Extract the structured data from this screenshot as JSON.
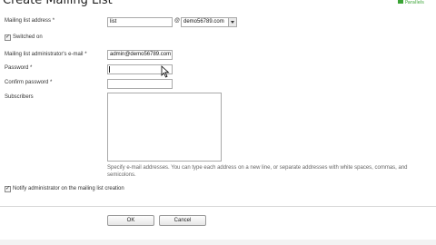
{
  "header": {
    "title": "Create Mailing List",
    "logo_text": "Parallels"
  },
  "form": {
    "mailing_list_address": {
      "label": "Mailing list address",
      "required_mark": "*",
      "value": "list",
      "at": "@",
      "domain_selected": "demo56789.com"
    },
    "switched_on": {
      "label": "Switched on",
      "checked": true,
      "check_glyph": "✓"
    },
    "admin_email": {
      "label": "Mailing list administrator's e-mail",
      "required_mark": "*",
      "value": "admin@demo56789.com"
    },
    "password": {
      "label": "Password",
      "required_mark": "*",
      "value": ""
    },
    "confirm_password": {
      "label": "Confirm password",
      "required_mark": "*",
      "value": ""
    },
    "subscribers": {
      "label": "Subscribers",
      "value": "",
      "hint_line1": "Specify e-mail addresses. You can type each address on a new line, or separate addresses with white spaces, commas, and",
      "hint_line2": "semicolons."
    },
    "notify_admin": {
      "label": "Notify administrator on the mailing list creation",
      "checked": true,
      "check_glyph": "✓"
    }
  },
  "buttons": {
    "ok_label": "OK",
    "cancel_label": "Cancel"
  },
  "colors": {
    "field_border": "#a9a9a9",
    "logo_green": "#3aa335"
  }
}
